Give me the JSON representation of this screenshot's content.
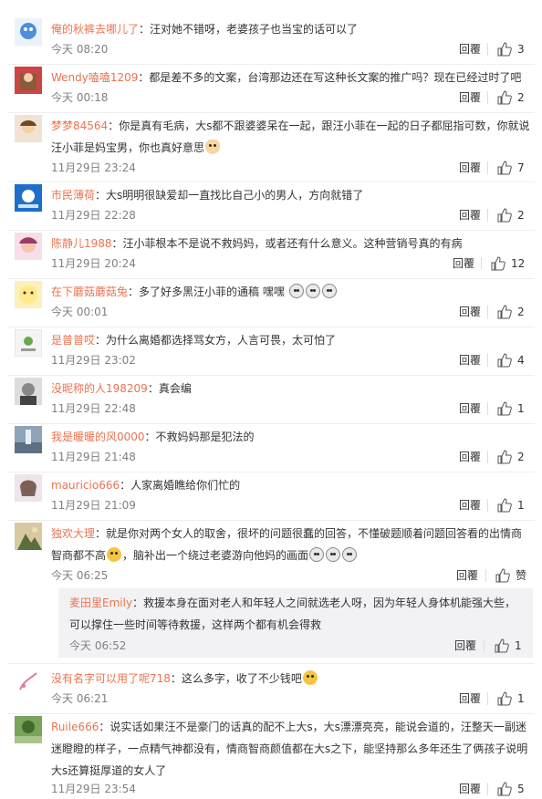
{
  "reply_label": "回覆",
  "comments": [
    {
      "user": "俺的秋裤去哪儿了",
      "text": "：汪对她不错呀，老婆孩子也当宝的话可以了",
      "time": "今天 08:20",
      "likes": "3"
    },
    {
      "user": "Wendy嗑嗑1209",
      "text": "：都是差不多的文案，台湾那边还在写这种长文案的推广吗？现在已经过时了吧",
      "time": "今天 00:18",
      "likes": "2"
    },
    {
      "user": "梦梦84564",
      "text": "：你是真有毛病，大s都不跟婆婆呆在一起，跟汪小菲在一起的日子都屈指可数，你就说汪小菲是妈宝男，你也真好意思",
      "time": "11月29日 23:24",
      "likes": "7"
    },
    {
      "user": "市民薄荷",
      "text": "：大s明明很缺爱却一直找比自己小的男人，方向就错了",
      "time": "11月29日 22:28",
      "likes": "2"
    },
    {
      "user": "陈静儿1988",
      "text": "：汪小菲根本不是说不救妈妈，或者还有什么意义。这种营销号真的有病",
      "time": "11月29日 20:24",
      "likes": "12"
    },
    {
      "user": "在下蘑菇蘑菇兔",
      "text": "：多了好多黑汪小菲的通稿 嘿嘿",
      "time": "今天 00:01",
      "likes": "2"
    },
    {
      "user": "是普普哎",
      "text": "：为什么离婚都选择骂女方，人言可畏，太可怕了",
      "time": "11月29日 23:02",
      "likes": "4"
    },
    {
      "user": "没昵称的人198209",
      "text": "：真会编",
      "time": "11月29日 22:48",
      "likes": "1"
    },
    {
      "user": "我是暖暖的风0000",
      "text": "：不救妈妈那是犯法的",
      "time": "11月29日 21:48",
      "likes": "2"
    },
    {
      "user": "mauricio666",
      "text": "：人家离婚瞧给你们忙的",
      "time": "11月29日 21:09",
      "likes": "1"
    },
    {
      "user": "独欢大理",
      "text": "：就是你对两个女人的取舍，很坏的问题很蠢的回答，不懂破题顺着问题回答看的出情商智商都不高",
      "text2": "，脑补出一个绕过老婆游向他妈的画面",
      "time": "今天 06:25",
      "likes": "赞"
    },
    {
      "user": "麦田里Emily",
      "text": "：救援本身在面对老人和年轻人之间就选老人呀，因为年轻人身体机能强大些，可以撑住一些时间等待救援，这样两个都有机会得救",
      "time": "今天 06:52",
      "likes": "1"
    },
    {
      "user": "没有名字可以用了呢718",
      "text": "：这么多字，收了不少钱吧",
      "time": "今天 06:21",
      "likes": "1"
    },
    {
      "user": "Ruile666",
      "text": "：说实话如果汪不是豪门的话真的配不上大s，大s漂漂亮亮，能说会道的，汪整天一副迷迷瞪瞪的样子，一点精气神都没有，情商智商颜值都在大s之下，能坚持那么多年还生了俩孩子说明大s还算挺厚道的女人了",
      "time": "11月29日 23:54",
      "likes": "5"
    }
  ],
  "colors": {
    "username": "#eb7350",
    "time": "#808080",
    "separator": "#eeeeee",
    "reply_bg": "#f2f2f5"
  }
}
